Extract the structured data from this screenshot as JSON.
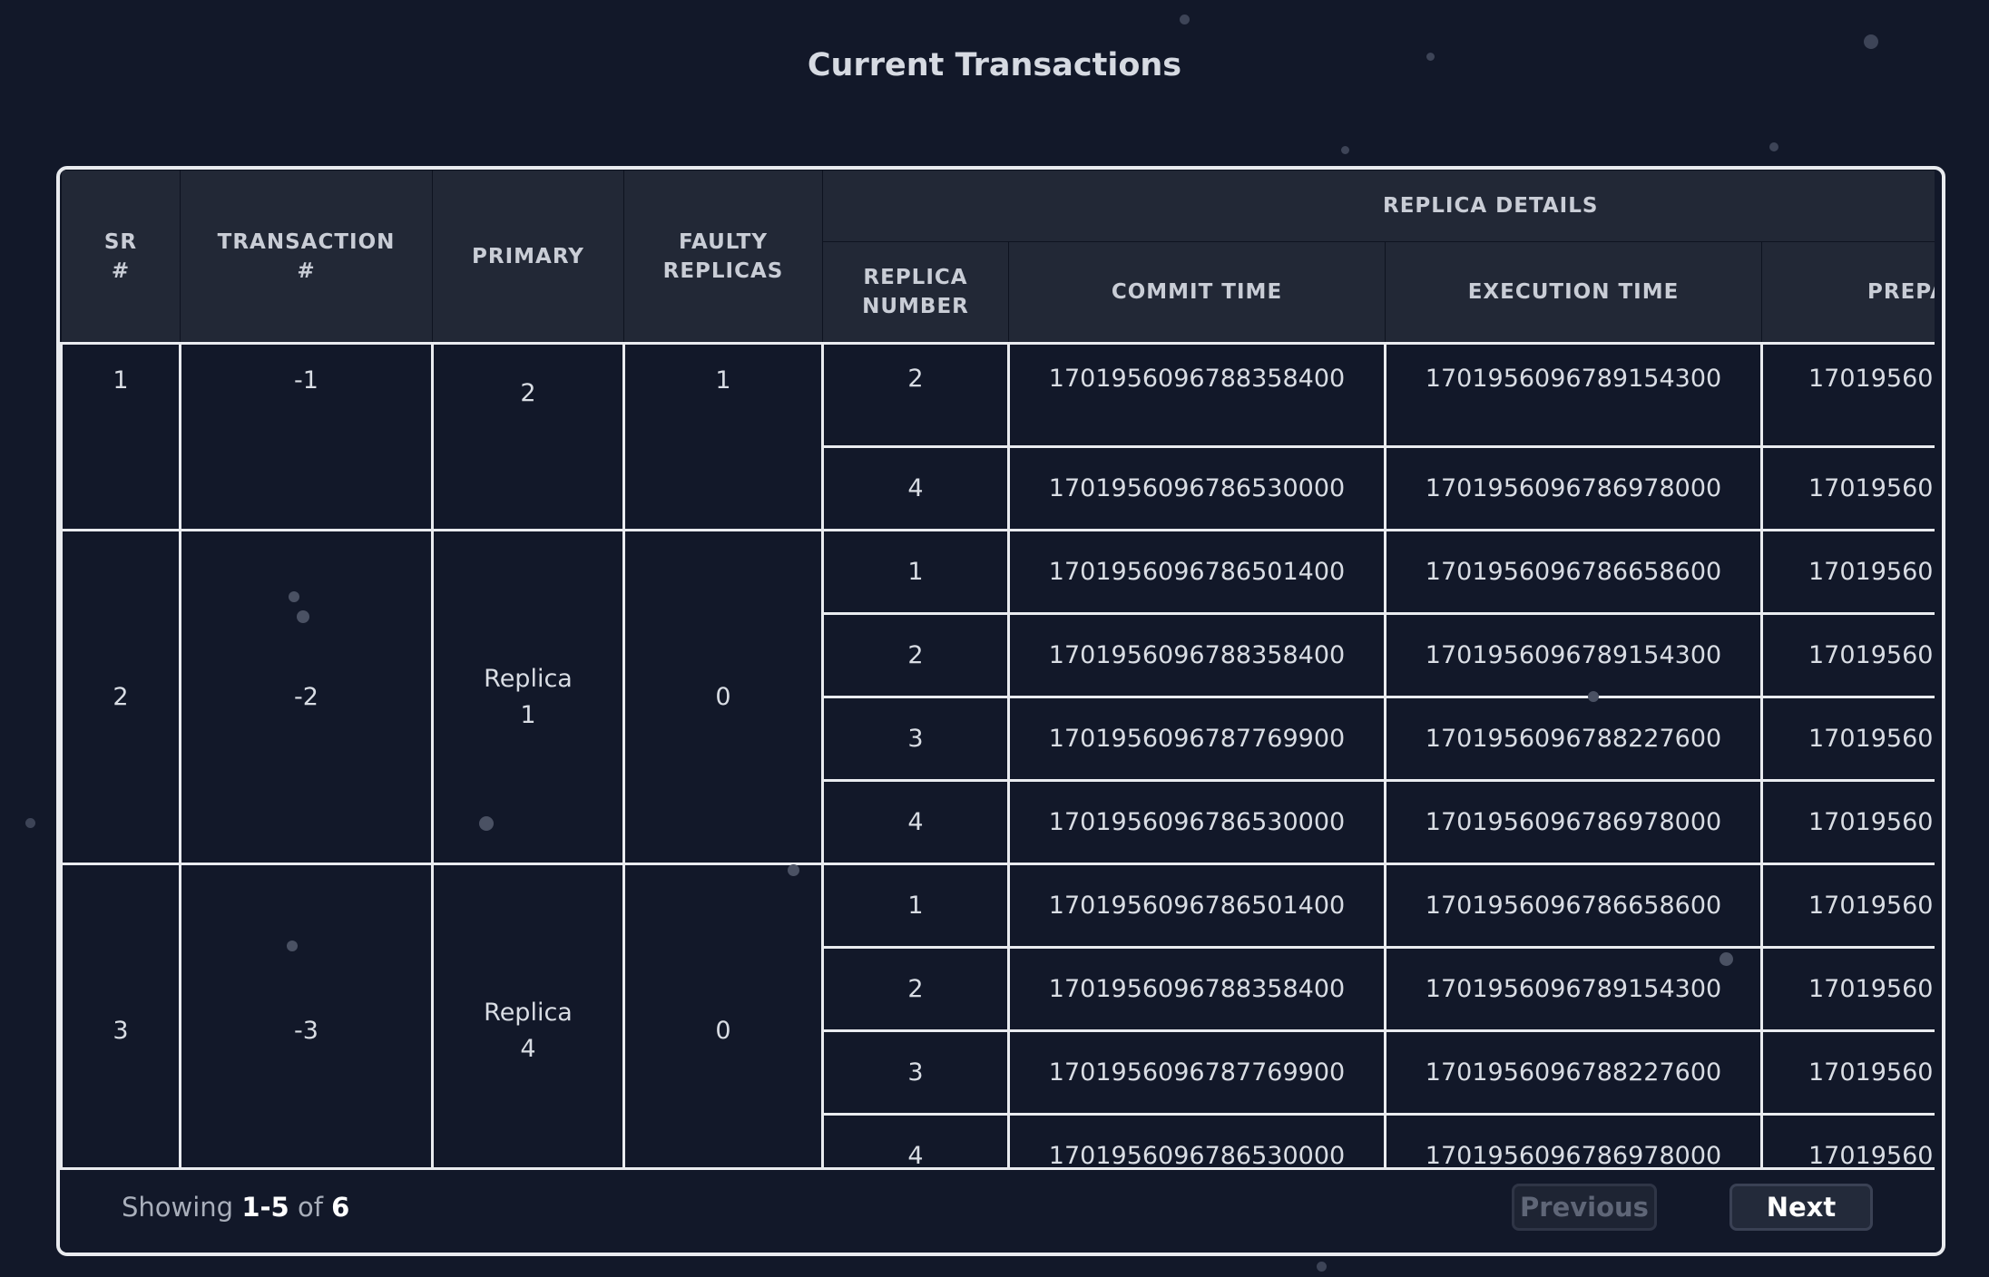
{
  "page": {
    "title": "Current Transactions"
  },
  "table": {
    "headers": {
      "sr": "SR\n#",
      "transaction": "TRANSACTION\n#",
      "primary": "PRIMARY",
      "faulty": "FAULTY\nREPLICAS",
      "replica_details": "REPLICA DETAILS",
      "replica_number": "REPLICA\nNUMBER",
      "commit_time": "COMMIT TIME",
      "execution_time": "EXECUTION TIME",
      "prepare_partial": "PREPA"
    },
    "groups": [
      {
        "sr": "1",
        "transaction": "-1",
        "primary": "2",
        "faulty": "1",
        "rows": [
          {
            "replica": "2",
            "commit": "1701956096788358400",
            "execution": "1701956096789154300",
            "prepare": "17019560"
          },
          {
            "replica": "4",
            "commit": "1701956096786530000",
            "execution": "1701956096786978000",
            "prepare": "17019560"
          }
        ]
      },
      {
        "sr": "2",
        "transaction": "-2",
        "primary_line1": "Replica",
        "primary_line2": "1",
        "faulty": "0",
        "rows": [
          {
            "replica": "1",
            "commit": "1701956096786501400",
            "execution": "1701956096786658600",
            "prepare": "17019560"
          },
          {
            "replica": "2",
            "commit": "1701956096788358400",
            "execution": "1701956096789154300",
            "prepare": "17019560"
          },
          {
            "replica": "3",
            "commit": "1701956096787769900",
            "execution": "1701956096788227600",
            "prepare": "17019560"
          },
          {
            "replica": "4",
            "commit": "1701956096786530000",
            "execution": "1701956096786978000",
            "prepare": "17019560"
          }
        ]
      },
      {
        "sr": "3",
        "transaction": "-3",
        "primary_line1": "Replica",
        "primary_line2": "4",
        "faulty": "0",
        "rows": [
          {
            "replica": "1",
            "commit": "1701956096786501400",
            "execution": "1701956096786658600",
            "prepare": "17019560"
          },
          {
            "replica": "2",
            "commit": "1701956096788358400",
            "execution": "1701956096789154300",
            "prepare": "17019560"
          },
          {
            "replica": "3",
            "commit": "1701956096787769900",
            "execution": "1701956096788227600",
            "prepare": "17019560"
          },
          {
            "replica": "4",
            "commit": "1701956096786530000",
            "execution": "1701956096786978000",
            "prepare": "17019560"
          }
        ]
      }
    ]
  },
  "pagination": {
    "showing_label": "Showing",
    "range": "1-5",
    "of_label": "of",
    "total": "6",
    "prev_label": "Previous",
    "next_label": "Next"
  }
}
